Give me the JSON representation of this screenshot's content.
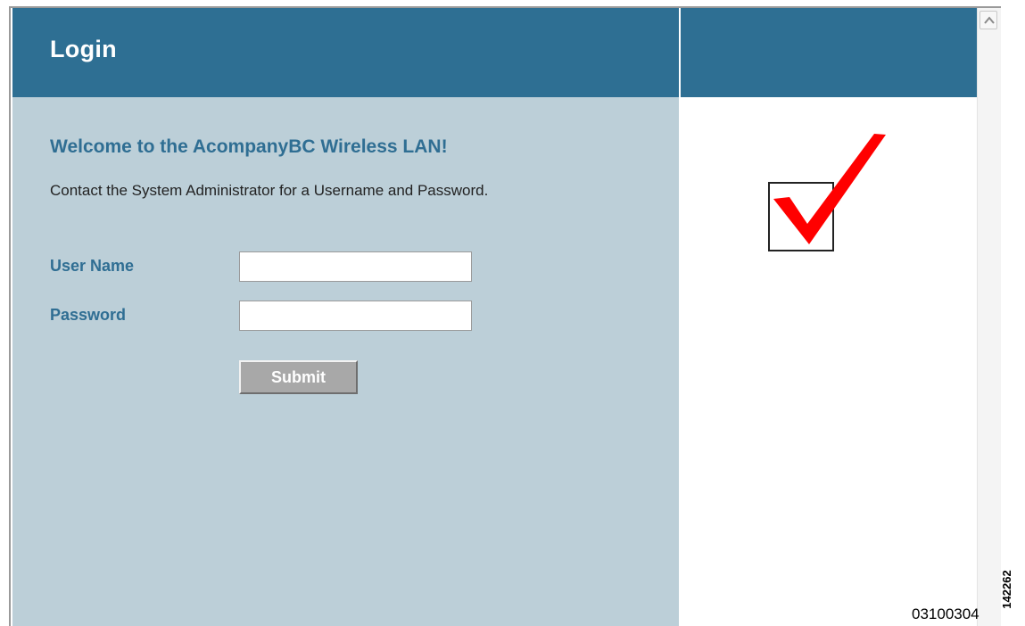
{
  "header": {
    "title": "Login"
  },
  "form": {
    "welcome": "Welcome to the AcompanyBC Wireless LAN!",
    "instructions": "Contact the System Administrator for a Username and Password.",
    "username_label": "User Name",
    "username_value": "",
    "password_label": "Password",
    "password_value": "",
    "submit_label": "Submit"
  },
  "figure": {
    "reference_number": "03100304",
    "figure_id": "142262"
  },
  "icons": {
    "checkmark": "checkmark-icon",
    "scroll_up": "chevron-up-icon"
  },
  "colors": {
    "header": "#2e6f93",
    "panel": "#bccfd8",
    "label": "#2f6e93",
    "checkmark": "#ff0000",
    "button": "#a8a8a8"
  }
}
